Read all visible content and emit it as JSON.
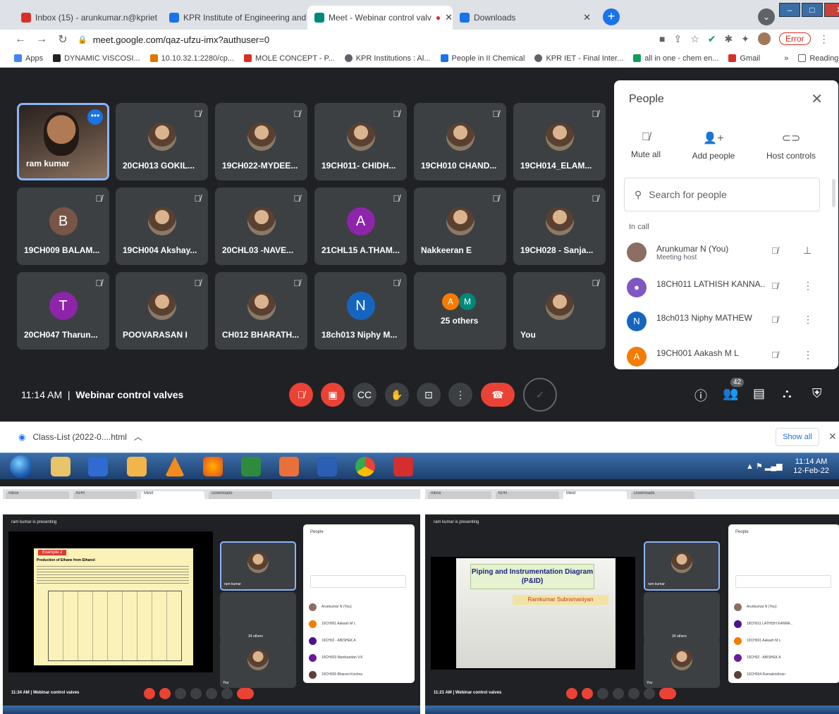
{
  "browser": {
    "tabs": [
      {
        "label": "Inbox (15) - arunkumar.n@kpriet",
        "fav": "#d93025"
      },
      {
        "label": "KPR Institute of Engineering and",
        "fav": "#1a73e8"
      },
      {
        "label": "Meet - Webinar control valv",
        "fav": "#00897b"
      },
      {
        "label": "Downloads",
        "fav": "#1a73e8"
      }
    ],
    "url": "meet.google.com/qaz-ufzu-imx?authuser=0",
    "error_label": "Error",
    "bookmarks": [
      {
        "label": "Apps",
        "color": "#4285f4"
      },
      {
        "label": "DYNAMIC VISCOSI...",
        "color": "#202124"
      },
      {
        "label": "10.10.32.1:2280/cp...",
        "color": "#e37400"
      },
      {
        "label": "MOLE CONCEPT - P...",
        "color": "#d93025"
      },
      {
        "label": "KPR Institutions : Al...",
        "color": "#5f6368"
      },
      {
        "label": "People in II Chemical",
        "color": "#1a73e8"
      },
      {
        "label": "KPR IET - Final Inter...",
        "color": "#5f6368"
      },
      {
        "label": "all in one - chem en...",
        "color": "#0f9d58"
      },
      {
        "label": "Gmail",
        "color": "#d93025"
      }
    ],
    "bookmarks_more": "»",
    "reading_list": "Reading list"
  },
  "meet": {
    "tiles": [
      {
        "name": "ram kumar",
        "kind": "self"
      },
      {
        "name": "20CH013 GOKIL...",
        "kind": "photo"
      },
      {
        "name": "19CH022-MYDEE...",
        "kind": "photo"
      },
      {
        "name": "19CH011- CHIDH...",
        "kind": "photo"
      },
      {
        "name": "19CH010 CHAND...",
        "kind": "photo"
      },
      {
        "name": "19CH014_ELAM...",
        "kind": "photo"
      },
      {
        "name": "19CH009 BALAM...",
        "kind": "letter",
        "letter": "B",
        "color": "#795548"
      },
      {
        "name": "19CH004 Akshay...",
        "kind": "photo"
      },
      {
        "name": "20CHL03 -NAVE...",
        "kind": "photo"
      },
      {
        "name": "21CHL15 A.THAM...",
        "kind": "letter",
        "letter": "A",
        "color": "#8e24aa"
      },
      {
        "name": "Nakkeeran E",
        "kind": "photo"
      },
      {
        "name": "19CH028 - Sanja...",
        "kind": "photo"
      },
      {
        "name": "20CH047 Tharun...",
        "kind": "letter",
        "letter": "T",
        "color": "#8e24aa"
      },
      {
        "name": "POOVARASAN I",
        "kind": "photo"
      },
      {
        "name": "CH012 BHARATH...",
        "kind": "photo"
      },
      {
        "name": "18ch013 Niphy M...",
        "kind": "letter",
        "letter": "N",
        "color": "#1565c0"
      },
      {
        "name": "25 others",
        "kind": "others"
      },
      {
        "name": "You",
        "kind": "photo"
      }
    ],
    "time": "11:14 AM",
    "meeting_title": "Webinar control valves",
    "participant_count": "42"
  },
  "people": {
    "title": "People",
    "mute_all": "Mute all",
    "add_people": "Add people",
    "host_controls": "Host controls",
    "search_placeholder": "Search for people",
    "in_call": "In call",
    "list": [
      {
        "name": "Arunkumar N (You)",
        "sub": "Meeting host",
        "color": "#8d6e63",
        "letter": ""
      },
      {
        "name": "18CH011 LATHISH KANNA...",
        "sub": "",
        "color": "#7e57c2",
        "letter": ""
      },
      {
        "name": "18ch013 Niphy MATHEW",
        "sub": "",
        "color": "#1565c0",
        "letter": "N"
      },
      {
        "name": "19CH001 Aakash M L",
        "sub": "",
        "color": "#f57c00",
        "letter": "A"
      }
    ]
  },
  "downloads": {
    "file": "Class-List (2022-0....html",
    "show_all": "Show all"
  },
  "taskbar": {
    "time": "11:14 AM",
    "date": "12-Feb-22"
  },
  "thumb1": {
    "presenting": "ram kumar is presenting",
    "example": "Example 2",
    "slide_title": "Production of Ethane from Ethanol",
    "others": "34 others",
    "you": "You",
    "time": "11:34 AM",
    "meeting": "Webinar control valves",
    "people": [
      "Arunkumar N (You)",
      "19CH001 Aakash M L",
      "19CH02 - ABISHEK A",
      "19CH003 Manikandan V.K",
      "19CH005 Bharani Krishna"
    ]
  },
  "thumb2": {
    "presenting": "ram kumar is presenting",
    "slide_title": "Piping and Instrumentation Diagram (P&ID)",
    "slide_author": "Ramkumar Subramaniyan",
    "others": "34 others",
    "you": "You",
    "time": "11:21 AM",
    "meeting": "Webinar control valves",
    "people": [
      "Arunkumar N (You)",
      "18CH011 LATHISH KANNA...",
      "19CH001 Aakash M L",
      "19CH02 - ABISHEK A",
      "19CH004 Ramakrishnan"
    ]
  }
}
